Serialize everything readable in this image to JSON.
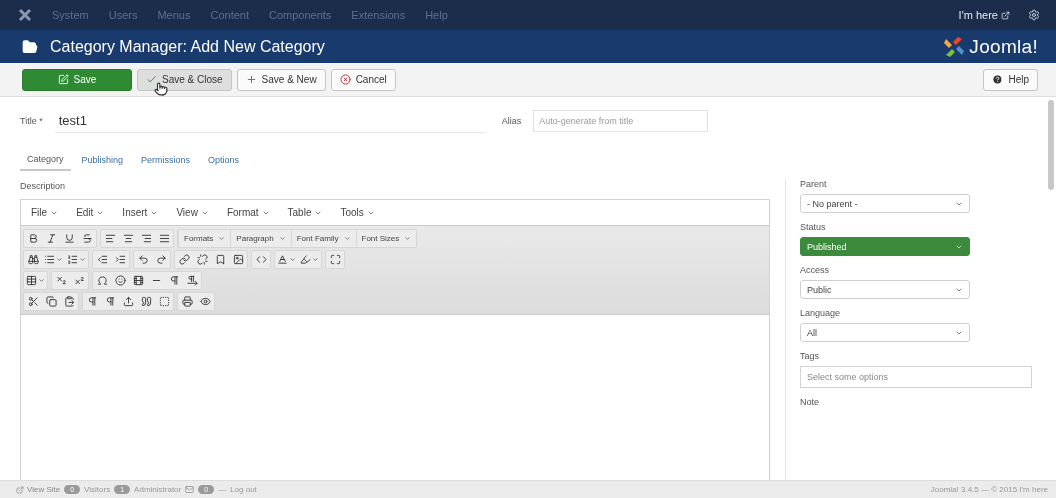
{
  "topnav": {
    "menu": [
      "System",
      "Users",
      "Menus",
      "Content",
      "Components",
      "Extensions",
      "Help"
    ],
    "user": "I'm here"
  },
  "header": {
    "title": "Category Manager: Add New Category",
    "brand": "Joomla!"
  },
  "toolbar": {
    "buttons": [
      {
        "label": "Save",
        "kind": "save",
        "hovered": false
      },
      {
        "label": "Save & Close",
        "kind": "save-close",
        "hovered": true
      },
      {
        "label": "Save & New",
        "kind": "save-new",
        "hovered": false
      },
      {
        "label": "Cancel",
        "kind": "cancel",
        "hovered": false
      }
    ],
    "help": "Help"
  },
  "form": {
    "title": {
      "label": "Title",
      "mark": "*",
      "value": "test1"
    },
    "alias": {
      "label": "Alias",
      "placeholder": "Auto-generate from title"
    }
  },
  "tabs": [
    {
      "label": "Category",
      "selected": true
    },
    {
      "label": "Publishing",
      "selected": false
    },
    {
      "label": "Permissions",
      "selected": false
    },
    {
      "label": "Options",
      "selected": false
    }
  ],
  "description": {
    "label": "Description",
    "menu": [
      "File",
      "Edit",
      "Insert",
      "View",
      "Format",
      "Table",
      "Tools"
    ],
    "dropdowns": [
      "Formats",
      "Paragraph",
      "Font Family",
      "Font Sizes"
    ]
  },
  "sidebar": {
    "fields": [
      {
        "label": "Parent",
        "kind": "select",
        "value": "- No parent -"
      },
      {
        "label": "Status",
        "kind": "select",
        "value": "Published",
        "color": "#3c8a3c"
      },
      {
        "label": "Access",
        "kind": "select",
        "value": "Public"
      },
      {
        "label": "Language",
        "kind": "select",
        "value": "All"
      },
      {
        "label": "Tags",
        "kind": "tags",
        "placeholder": "Select some options"
      },
      {
        "label": "Note",
        "kind": "label"
      }
    ]
  },
  "footer": {
    "items": [
      {
        "kind": "link",
        "label": "View Site"
      },
      {
        "kind": "badge",
        "label": "0"
      },
      {
        "kind": "text",
        "label": "Visitors"
      },
      {
        "kind": "badge",
        "label": "1"
      },
      {
        "kind": "text",
        "label": "Administrator"
      },
      {
        "kind": "mail"
      },
      {
        "kind": "badge",
        "label": "0"
      },
      {
        "kind": "text",
        "label": "—"
      },
      {
        "kind": "text",
        "label": "Log out"
      }
    ],
    "copyright": "Joomla! 3.4.5 — © 2015 I'm here"
  }
}
